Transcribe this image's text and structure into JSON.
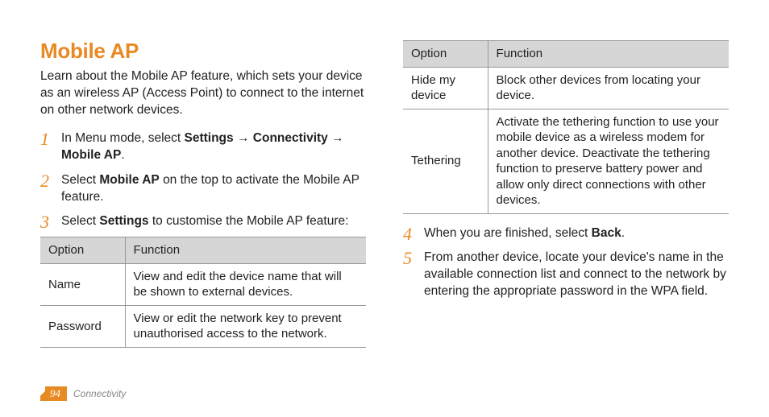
{
  "title": "Mobile AP",
  "intro": "Learn about the Mobile AP feature, which sets your device as an wireless AP (Access Point) to connect to the internet on other network devices.",
  "arrow": "→",
  "steps": {
    "s1": {
      "pre": "In Menu mode, select ",
      "p1": "Settings",
      "p2": "Connectivity",
      "p3": "Mobile AP",
      "post": "."
    },
    "s2": {
      "pre": "Select ",
      "b": "Mobile AP",
      "post": " on the top to activate the Mobile AP feature."
    },
    "s3": {
      "pre": "Select ",
      "b": "Settings",
      "post": " to customise the Mobile AP feature:"
    },
    "s4": {
      "pre": "When you are finished, select ",
      "b": "Back",
      "post": "."
    },
    "s5": {
      "text": "From another device, locate your device's name in the available connection list and connect to the network by entering the appropriate password in the WPA field."
    }
  },
  "table1": {
    "h1": "Option",
    "h2": "Function",
    "r1c1": "Name",
    "r1c2": "View and edit the device name that will be shown to external devices.",
    "r2c1": "Password",
    "r2c2": "View or edit the network key to prevent unauthorised access to the network."
  },
  "table2": {
    "h1": "Option",
    "h2": "Function",
    "r1c1": "Hide my device",
    "r1c2": "Block other devices from locating your device.",
    "r2c1": "Tethering",
    "r2c2": "Activate the tethering function to use your mobile device as a wireless modem for another device. Deactivate the tethering function to preserve battery power and allow only direct connections with other devices."
  },
  "footer": {
    "page": "94",
    "section": "Connectivity"
  }
}
